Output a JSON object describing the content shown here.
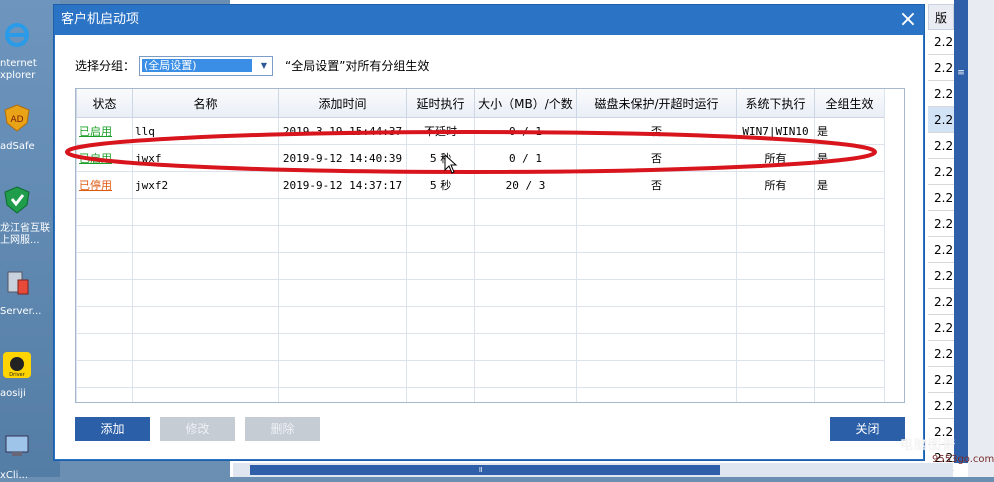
{
  "desktop": {
    "icons": [
      {
        "label_line1": "nternet",
        "label_line2": "xplorer",
        "icon": "ie-icon"
      },
      {
        "label_line1": "adSafe",
        "label_line2": "",
        "icon": "shield-icon"
      },
      {
        "label_line1": "龙江省互联",
        "label_line2": "上网服...",
        "icon": "shield-green-icon"
      },
      {
        "label_line1": "Server...",
        "label_line2": "",
        "icon": "server-icon"
      },
      {
        "label_line1": "aosiji",
        "label_line2": "",
        "icon": "car-icon"
      },
      {
        "label_line1": "xCli...",
        "label_line2": "",
        "icon": "client-icon"
      }
    ]
  },
  "background_app": {
    "column_header": "版",
    "cell_value": "2.2"
  },
  "dialog": {
    "title": "客户机启动项",
    "group_label": "选择分组：",
    "group_value": "(全局设置)",
    "group_note": "“全局设置”对所有分组生效",
    "columns": [
      "状态",
      "名称",
      "添加时间",
      "延时执行",
      "大小（MB）/个数",
      "磁盘未保护/开超时运行",
      "系统下执行",
      "全组生效"
    ],
    "rows": [
      {
        "status": "已启用",
        "status_kind": "on",
        "name": "llq",
        "time": "2019-3-19 15:44:37",
        "delay": "不延时",
        "size": "0 / 1",
        "disk": "否",
        "system": "WIN7|WIN10",
        "global": "是"
      },
      {
        "status": "已启用",
        "status_kind": "on",
        "name": "jwxf",
        "time": "2019-9-12 14:40:39",
        "delay": "5 秒",
        "size": "0 / 1",
        "disk": "否",
        "system": "所有",
        "global": "是"
      },
      {
        "status": "已停用",
        "status_kind": "off",
        "name": "jwxf2",
        "time": "2019-9-12 14:37:17",
        "delay": "5 秒",
        "size": "20 / 3",
        "disk": "否",
        "system": "所有",
        "global": "是"
      }
    ],
    "buttons": {
      "add": "添加",
      "edit": "修改",
      "delete": "删除",
      "close": "关闭"
    }
  },
  "watermark": {
    "line1": "电脑图谱",
    "line2": "9553go.com"
  },
  "colors": {
    "dialog_blue": "#2b73c4",
    "button_blue": "#2b5fa8",
    "enabled_green": "#1a9f27",
    "disabled_orange": "#e05a14",
    "annotation_red": "#d8151c"
  }
}
